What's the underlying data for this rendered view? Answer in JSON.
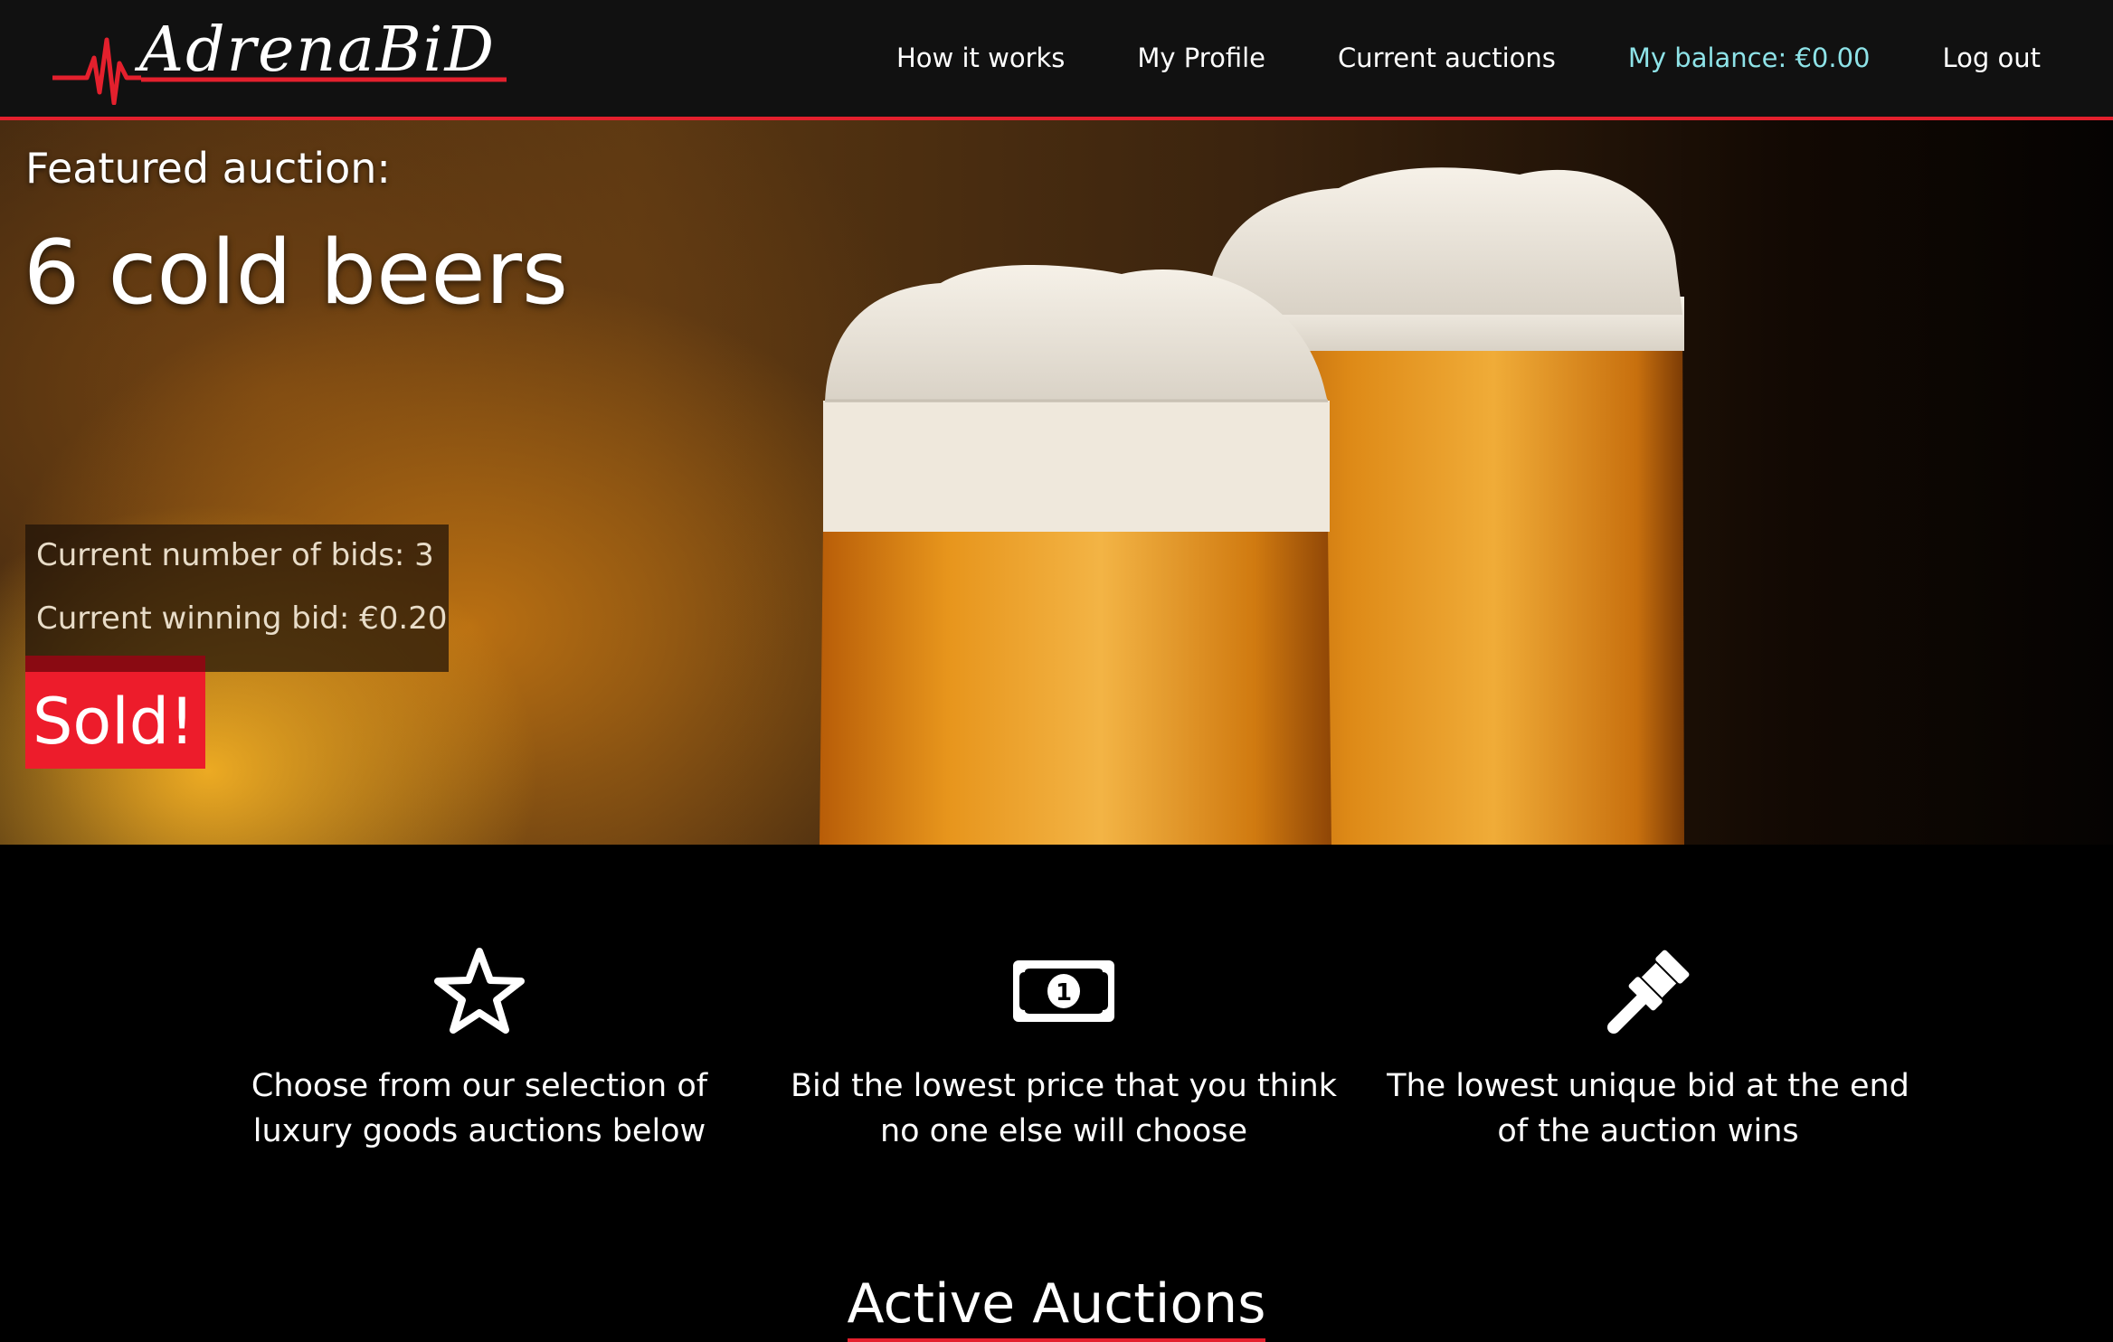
{
  "brand": {
    "logo_text": "AdrenaBiD",
    "accent_color": "#e4202d"
  },
  "nav": {
    "items": [
      {
        "label": "How it works"
      },
      {
        "label": "My Profile"
      },
      {
        "label": "Current auctions"
      },
      {
        "label": "My balance: €0.00"
      },
      {
        "label": "Log out"
      }
    ],
    "balance_color": "#8ee3e8"
  },
  "featured": {
    "label": "Featured auction:",
    "title": "6 cold beers",
    "bids_text": "Current number of bids: 3",
    "winning_text": "Current winning bid: €0.20",
    "status": "Sold!",
    "status_color": "#ed1c2b"
  },
  "features": [
    {
      "icon": "star-icon",
      "text": "Choose from our selection of luxury goods auctions below"
    },
    {
      "icon": "banknote-icon",
      "text": "Bid the lowest price that you think no one else will choose"
    },
    {
      "icon": "gavel-icon",
      "text": "The lowest unique bid at the end of the auction wins"
    }
  ],
  "active_heading": "Active Auctions"
}
